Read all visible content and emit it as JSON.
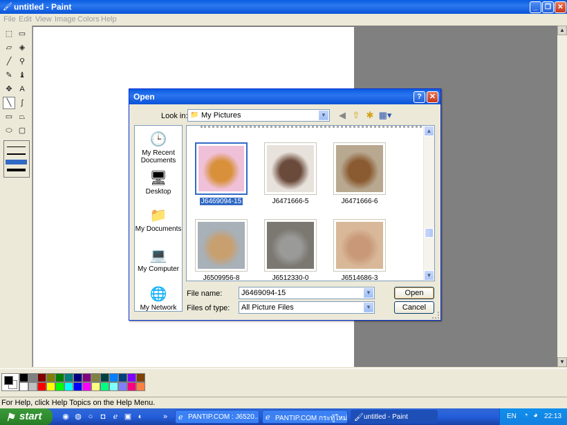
{
  "window": {
    "title": "untitled - Paint"
  },
  "menu": [
    "File",
    "Edit",
    "View",
    "Image",
    "Colors",
    "Help"
  ],
  "tools": [
    {
      "name": "free-form-select-icon",
      "glyph": "⬚"
    },
    {
      "name": "select-icon",
      "glyph": "▭"
    },
    {
      "name": "eraser-icon",
      "glyph": "▱"
    },
    {
      "name": "fill-icon",
      "glyph": "◈"
    },
    {
      "name": "pick-color-icon",
      "glyph": "╱"
    },
    {
      "name": "magnifier-icon",
      "glyph": "⚲"
    },
    {
      "name": "pencil-icon",
      "glyph": "✎"
    },
    {
      "name": "brush-icon",
      "glyph": "♝"
    },
    {
      "name": "airbrush-icon",
      "glyph": "✥"
    },
    {
      "name": "text-icon",
      "glyph": "A"
    },
    {
      "name": "line-icon",
      "glyph": "╲"
    },
    {
      "name": "curve-icon",
      "glyph": "∫"
    },
    {
      "name": "rectangle-icon",
      "glyph": "▭"
    },
    {
      "name": "polygon-icon",
      "glyph": "⏢"
    },
    {
      "name": "ellipse-icon",
      "glyph": "⬭"
    },
    {
      "name": "rounded-rectangle-icon",
      "glyph": "▢"
    }
  ],
  "palette": {
    "row1": [
      "#000000",
      "#808080",
      "#800000",
      "#808000",
      "#008000",
      "#008080",
      "#000080",
      "#800080",
      "#808040",
      "#004040",
      "#0080ff",
      "#004080",
      "#8000ff",
      "#804000"
    ],
    "row2": [
      "#ffffff",
      "#c0c0c0",
      "#ff0000",
      "#ffff00",
      "#00ff00",
      "#00ffff",
      "#0000ff",
      "#ff00ff",
      "#ffff80",
      "#00ff80",
      "#80ffff",
      "#8080ff",
      "#ff0080",
      "#ff8040"
    ],
    "primary": "#000000",
    "secondary": "#ffffff"
  },
  "status": {
    "text": "For Help, click Help Topics on the Help Menu."
  },
  "dialog": {
    "title": "Open",
    "look_in_label": "Look in:",
    "look_in_value": "My Pictures",
    "places": [
      {
        "name": "place-my-recent-documents",
        "label": "My Recent Documents",
        "glyph": "🕒"
      },
      {
        "name": "place-desktop",
        "label": "Desktop",
        "glyph": "🖥"
      },
      {
        "name": "place-my-documents",
        "label": "My Documents",
        "glyph": "📁"
      },
      {
        "name": "place-my-computer",
        "label": "My Computer",
        "glyph": "💻"
      },
      {
        "name": "place-my-network",
        "label": "My Network",
        "glyph": "🌐"
      }
    ],
    "files": [
      {
        "label": "J6469094-15",
        "selected": true,
        "colors": [
          "#f0c0d8",
          "#d8903a"
        ]
      },
      {
        "label": "J6471666-5",
        "selected": false,
        "colors": [
          "#e8e2dc",
          "#6a4a3a"
        ]
      },
      {
        "label": "J6471666-6",
        "selected": false,
        "colors": [
          "#b8a890",
          "#8a5a30"
        ]
      },
      {
        "label": "J6509956-8",
        "selected": false,
        "colors": [
          "#a8b0b8",
          "#c8a070"
        ]
      },
      {
        "label": "J6512330-0",
        "selected": false,
        "colors": [
          "#7a7870",
          "#9a9a98"
        ]
      },
      {
        "label": "J6514686-3",
        "selected": false,
        "colors": [
          "#d8b898",
          "#c89878"
        ]
      }
    ],
    "file_name_label": "File name:",
    "file_name_value": "J6469094-15",
    "files_of_type_label": "Files of type:",
    "files_of_type_value": "All Picture Files",
    "open_label": "Open",
    "cancel_label": "Cancel"
  },
  "taskbar": {
    "start_label": "start",
    "tasks": [
      {
        "label": "PANTIP.COM : J6520...",
        "icon": "ie-icon",
        "active": false
      },
      {
        "label": "PANTIP.COM กระทู้ใหม่...",
        "icon": "ie-icon",
        "active": false
      },
      {
        "label": "untitled - Paint",
        "icon": "paint-icon",
        "active": true
      }
    ],
    "language": "EN",
    "clock": "22:13"
  }
}
